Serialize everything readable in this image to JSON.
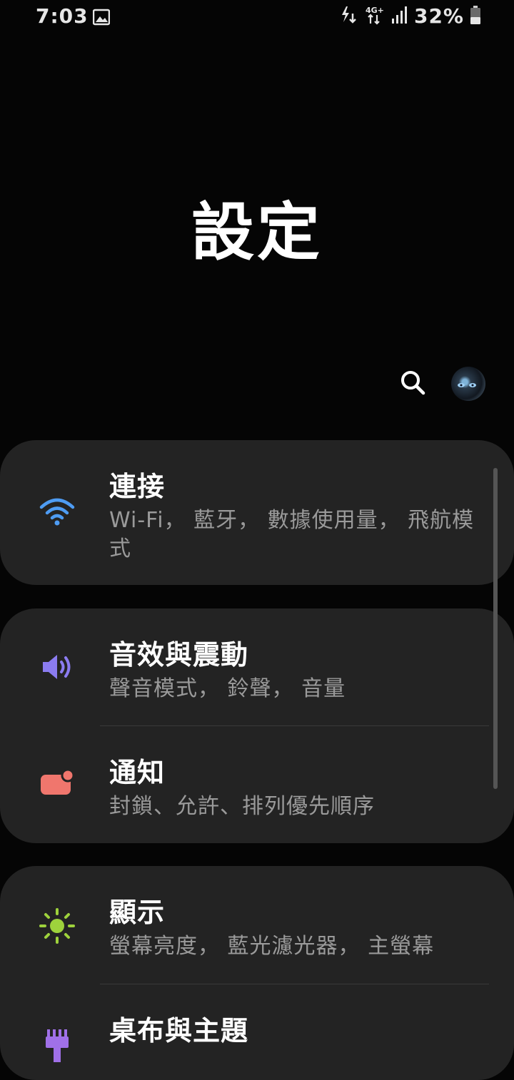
{
  "status_bar": {
    "time": "7:03",
    "network": "4G+",
    "battery": "32%",
    "icons": [
      "image-icon",
      "data-saver-icon",
      "lte-icon",
      "signal-icon",
      "battery-icon"
    ]
  },
  "header": {
    "title": "設定"
  },
  "toolbar": {
    "icons": [
      "search-icon",
      "avatar"
    ]
  },
  "settings": [
    {
      "title": "連接",
      "subtitle": "Wi-Fi， 藍牙， 數據使用量， 飛航模式",
      "icon": "wifi-icon",
      "color": "#4e9cf3"
    },
    {
      "title": "音效與震動",
      "subtitle": "聲音模式， 鈴聲， 音量",
      "icon": "volume-icon",
      "color": "#8b7cf0"
    },
    {
      "title": "通知",
      "subtitle": "封鎖、允許、排列優先順序",
      "icon": "notification-icon",
      "color": "#f0766d"
    },
    {
      "title": "顯示",
      "subtitle": "螢幕亮度， 藍光濾光器， 主螢幕",
      "icon": "brightness-icon",
      "color": "#9ed23c"
    },
    {
      "title": "桌布與主題",
      "subtitle": "",
      "icon": "theme-brush-icon",
      "color": "#a070e8"
    }
  ]
}
